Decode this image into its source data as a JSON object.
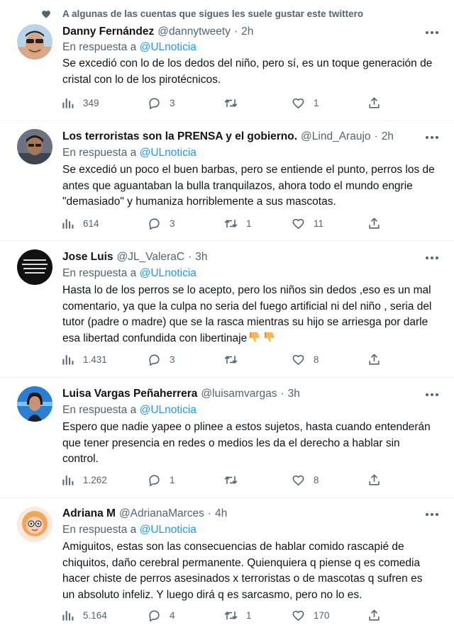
{
  "top_note": {
    "text": "A algunas de las cuentas que sigues les suele gustar este twittero",
    "icon": "heart-icon"
  },
  "reply_prefix": "En respuesta a",
  "tweets": [
    {
      "name": "Danny Fernández",
      "handle": "@dannytweety",
      "time": "2h",
      "reply_to": "@ULnoticia",
      "lines": [
        "Se excedió con lo de los dedos del niño, pero sí, es un toque generación de",
        "cristal con lo de los pirotécnicos."
      ],
      "views": "349",
      "replies": "3",
      "retweets": "",
      "likes": "1"
    },
    {
      "name": "Los terroristas son la PRENSA y el gobierno.",
      "handle": "@Lind_Araujo",
      "time": "2h",
      "reply_to": "@ULnoticia",
      "lines": [
        "Se excedió un poco el buen barbas, pero se entiende el punto, perros los de",
        "antes que aguantaban la bulla tranquilazos, ahora todo el mundo engrie",
        "\"demasiado\" y humaniza horriblemente a sus mascotas."
      ],
      "views": "614",
      "replies": "3",
      "retweets": "1",
      "likes": "11"
    },
    {
      "name": "Jose Luis",
      "handle": "@JL_ValeraC",
      "time": "3h",
      "reply_to": "@ULnoticia",
      "avatar_text": "PAYASOS SIN PATRIOTAS, SON TODO QUE NO LES GUSTE DEL NAIDO",
      "lines": [
        "Hasta lo de los perros se lo acepto, pero los niños sin dedos ,eso es un mal",
        "comentario, ya que la culpa no seria del fuego artificial ni del niño , seria del",
        "tutor (padre o madre) que se la rasca mientras su hijo se arriesga por darle",
        "esa libertad confundida con libertinaje"
      ],
      "views": "1.431",
      "replies": "3",
      "retweets": "",
      "likes": "8"
    },
    {
      "name": "Luisa Vargas Peñaherrera",
      "handle": "@luisamvargas",
      "time": "3h",
      "reply_to": "@ULnoticia",
      "lines": [
        "Espero que nadie yapee o plinee a estos sujetos, hasta cuando entenderán",
        "que tener presencia en redes o medios les da el derecho a hablar sin",
        "control."
      ],
      "views": "1.262",
      "replies": "1",
      "retweets": "",
      "likes": "8"
    },
    {
      "name": "Adriana M",
      "handle": "@AdrianaMarces",
      "time": "4h",
      "reply_to": "@ULnoticia",
      "lines": [
        "Amiguitos, estas son las consecuencias de hablar comido rascapié de",
        "chiquitos, daño cerebral permanente. Quienquiera q piense q es comedia",
        "hacer chiste de perros asesinados x terroristas o de mascotas q sufren es",
        "un absoluto infeliz. Y luego dirá q es sarcasmo, pero no lo es."
      ],
      "views": "5.164",
      "replies": "4",
      "retweets": "1",
      "likes": "170"
    }
  ],
  "colors": {
    "link": "#1d9bf0",
    "muted": "#536471",
    "text": "#0f1419",
    "divider": "#eff3f4"
  }
}
